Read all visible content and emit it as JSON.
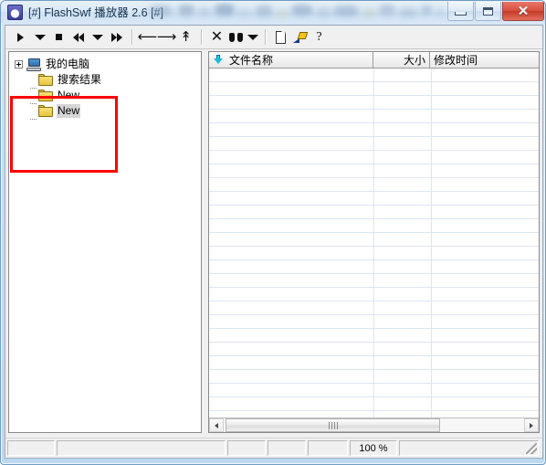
{
  "window": {
    "title": "[#] FlashSwf 播放器 2.6 [#]",
    "app_icon": "app-icon",
    "buttons": {
      "minimize": "minimize",
      "maximize": "maximize",
      "close": "close"
    }
  },
  "toolbar": {
    "items": [
      {
        "name": "play-button",
        "icon": "play-icon"
      },
      {
        "name": "play-dropdown",
        "icon": "chevron-down-icon"
      },
      {
        "name": "stop-button",
        "icon": "stop-icon"
      },
      {
        "name": "rewind-button",
        "icon": "rewind-icon"
      },
      {
        "name": "rewind-dropdown",
        "icon": "chevron-down-icon"
      },
      {
        "name": "fast-forward-button",
        "icon": "fast-forward-icon"
      },
      {
        "name": "back-button",
        "icon": "arrow-left-icon"
      },
      {
        "name": "forward-button",
        "icon": "arrow-right-icon"
      },
      {
        "name": "up-button",
        "icon": "arrow-up-icon"
      },
      {
        "name": "delete-button",
        "icon": "close-x-icon"
      },
      {
        "name": "search-button",
        "icon": "binoculars-icon"
      },
      {
        "name": "search-dropdown",
        "icon": "chevron-down-icon"
      },
      {
        "name": "new-button",
        "icon": "document-icon"
      },
      {
        "name": "edit-button",
        "icon": "pen-icon"
      },
      {
        "name": "help-button",
        "icon": "question-mark-icon"
      }
    ]
  },
  "tree": {
    "nodes": [
      {
        "label": "我的电脑",
        "icon": "computer-icon",
        "expandable": true,
        "selected": false
      },
      {
        "label": "搜索结果",
        "icon": "folder-icon",
        "expandable": false,
        "selected": false
      },
      {
        "label": "New",
        "icon": "folder-icon",
        "expandable": false,
        "selected": false
      },
      {
        "label": "New",
        "icon": "folder-icon",
        "expandable": false,
        "selected": true
      }
    ]
  },
  "annotation": {
    "color": "#ff0000",
    "shape": "rectangle"
  },
  "filelist": {
    "columns": [
      {
        "label": "文件名称",
        "align": "left",
        "sorted": true
      },
      {
        "label": "大小",
        "align": "right",
        "sorted": false
      },
      {
        "label": "修改时间",
        "align": "left",
        "sorted": false
      }
    ],
    "rows": []
  },
  "hscrollbar": {
    "left_arrow": "arrow-left-icon",
    "right_arrow": "arrow-right-icon"
  },
  "statusbar": {
    "panels": [
      "",
      "",
      "",
      "",
      "",
      "100 %",
      ""
    ],
    "zoom": "100 %",
    "resize_grip": "resize-grip-icon"
  }
}
